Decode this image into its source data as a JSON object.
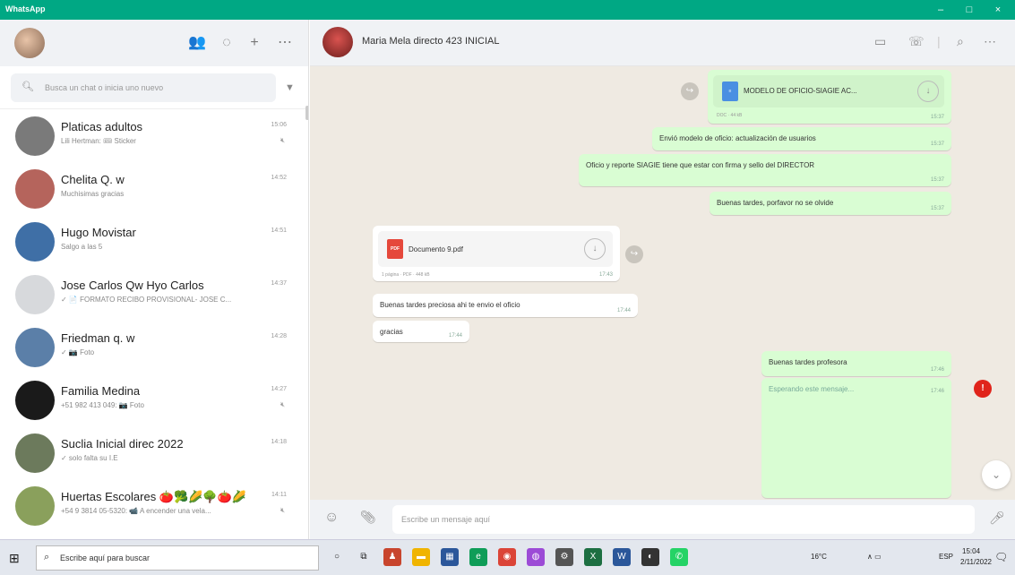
{
  "window": {
    "title": "WhatsApp",
    "controls": [
      "–",
      "□",
      "×"
    ]
  },
  "sidebar": {
    "search": {
      "placeholder": "Busca un chat o inicia uno nuevo"
    },
    "chats": [
      {
        "name": "Platicas adultos",
        "preview": "Lili Hertman: 🎟 Sticker",
        "time": "15:06",
        "muted": true,
        "avatar_color": "#7a7a7a"
      },
      {
        "name": "Chelita Q. w",
        "preview": "Muchisimas gracias",
        "time": "14:52",
        "muted": false,
        "avatar_color": "#b5645c"
      },
      {
        "name": "Hugo Movistar",
        "preview": "Salgo a las 5",
        "time": "14:51",
        "muted": false,
        "avatar_color": "#3f6fa6"
      },
      {
        "name": "Jose Carlos Qw Hyo Carlos",
        "preview": "✓ 📄 FORMATO RECIBO PROVISIONAL- JOSE C...",
        "time": "14:37",
        "muted": false,
        "avatar_color": "#d7d9dc"
      },
      {
        "name": "Friedman q. w",
        "preview": "✓ 📷 Foto",
        "time": "14:28",
        "muted": false,
        "avatar_color": "#5b7fa8"
      },
      {
        "name": "Familia Medina",
        "preview": "+51 982 413 049: 📷 Foto",
        "time": "14:27",
        "muted": true,
        "avatar_color": "#1a1a1a"
      },
      {
        "name": "Suclia Inicial direc 2022",
        "preview": "✓ solo falta su I.E",
        "time": "14:18",
        "muted": false,
        "avatar_color": "#6c7a5c"
      },
      {
        "name": "Huertas Escolares 🍅🥦🌽🌳🍅🌽",
        "preview": "+54 9 3814 05-5320: 📹 A encender una vela...",
        "time": "14:11",
        "muted": true,
        "avatar_color": "#8aa05c"
      }
    ]
  },
  "chat": {
    "name": "Maria Mela directo 423 INICIAL",
    "messages": {
      "doc_out": {
        "name": "MODELO DE OFICIO-SIAGIE AC...",
        "meta": "DOC · 44 kB",
        "time": "15:37"
      },
      "out1": {
        "text": "Envió modelo de oficio: actualización de usuarios",
        "time": "15:37"
      },
      "out2": {
        "text": "Oficio y reporte SIAGIE tiene que estar con firma y sello del DIRECTOR",
        "time": "15:37"
      },
      "out3": {
        "text": "Buenas tardes, porfavor no se olvide",
        "time": "15:37"
      },
      "doc_in": {
        "name": "Documento 9.pdf",
        "meta": "1 página · PDF · 448 kB",
        "time": "17:43",
        "icon_label": "PDF"
      },
      "in1": {
        "text": "Buenas tardes preciosa ahi te envio el oficio",
        "time": "17:44"
      },
      "in2": {
        "text": "gracias",
        "time": "17:44"
      },
      "out4": {
        "text": "Buenas tardes profesora",
        "time": "17:46"
      },
      "out5": {
        "text": "Esperando este mensaje...",
        "time": "17:46"
      }
    },
    "unread_count": "!",
    "composer": {
      "placeholder": "Escribe un mensaje aquí"
    }
  },
  "taskbar": {
    "search_placeholder": "Escribe aquí para buscar",
    "weather": "16°C",
    "lang": "ESP",
    "time": "15:04",
    "date": "2/11/2022"
  },
  "colors": {
    "accent": "#00a884",
    "outgoing_bubble": "#d9fdd3",
    "chat_bg": "#efeae2",
    "pdf_red": "#e5483b",
    "doc_blue": "#4a8fe2"
  }
}
